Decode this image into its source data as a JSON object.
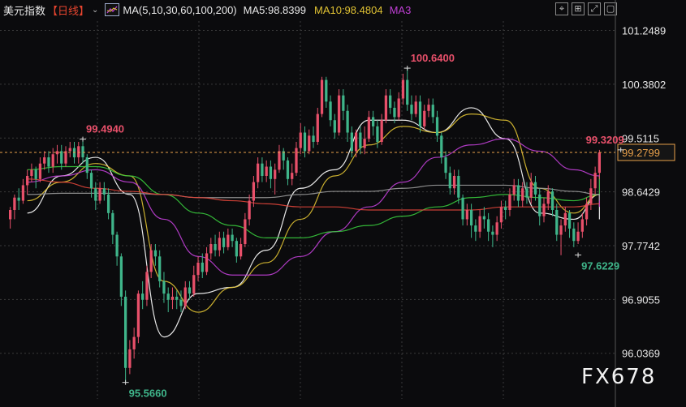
{
  "header": {
    "symbol": "美元指数",
    "period": "【日线】",
    "caret": "⌄",
    "ma_label": "MA(5,10,30,60,100,200)",
    "ma5": "MA5:98.8399",
    "ma10": "MA10:98.4804",
    "ma3": "MA3"
  },
  "toolbar": {
    "icons": [
      "crosshair-icon",
      "zoom-fit-icon",
      "fullscreen-icon",
      "window-icon"
    ],
    "glyphs": [
      "⌖",
      "⊞",
      "⤢",
      "▢"
    ]
  },
  "watermark": "FX678",
  "colors": {
    "up": "#e8506a",
    "down": "#3fb58a",
    "ma5": "#ffffff",
    "ma10": "#e0c233",
    "ma30": "#c03fd6",
    "ma60": "#37c93c",
    "ma100": "#9a9a9a",
    "ma200": "#e0453a",
    "current_price": "#e8a04a",
    "axis_text": "#e8e8e8",
    "grid": "#3a3a3a"
  },
  "chart_data": {
    "type": "candlestick",
    "ylim": [
      95.3,
      101.4
    ],
    "y_ticks": [
      "101.2489",
      "100.3802",
      "99.5115",
      "98.6429",
      "97.7742",
      "96.9055",
      "96.0369"
    ],
    "y_tick_values": [
      101.2489,
      100.3802,
      99.5115,
      98.6429,
      97.7742,
      96.9055,
      96.0369
    ],
    "grid": true,
    "current_price": 99.2799,
    "current_price_label": "99.2799",
    "annotations": [
      {
        "label": "99.4940",
        "index": 17,
        "value": 99.494,
        "color": "#e8506a"
      },
      {
        "label": "95.5660",
        "index": 27,
        "value": 95.566,
        "color": "#3fb58a"
      },
      {
        "label": "100.6400",
        "index": 93,
        "value": 100.64,
        "color": "#e8506a"
      },
      {
        "label": "99.3209",
        "index": 143,
        "value": 99.3209,
        "color": "#e8506a"
      },
      {
        "label": "97.6229",
        "index": 133,
        "value": 97.6229,
        "color": "#3fb58a"
      }
    ],
    "candles": [
      [
        98.2,
        98.35,
        98.05,
        98.4
      ],
      [
        98.35,
        98.55,
        98.2,
        98.6
      ],
      [
        98.55,
        98.5,
        98.35,
        98.7
      ],
      [
        98.5,
        98.75,
        98.45,
        98.85
      ],
      [
        98.75,
        98.9,
        98.6,
        99.0
      ],
      [
        98.9,
        99.0,
        98.8,
        99.1
      ],
      [
        99.0,
        98.85,
        98.7,
        99.05
      ],
      [
        98.85,
        99.1,
        98.8,
        99.2
      ],
      [
        99.1,
        99.2,
        99.0,
        99.3
      ],
      [
        99.2,
        99.05,
        98.95,
        99.3
      ],
      [
        99.05,
        99.25,
        98.95,
        99.35
      ],
      [
        99.25,
        99.3,
        99.1,
        99.4
      ],
      [
        99.3,
        99.1,
        99.0,
        99.4
      ],
      [
        99.1,
        99.3,
        99.05,
        99.38
      ],
      [
        99.3,
        99.35,
        99.2,
        99.45
      ],
      [
        99.35,
        99.2,
        99.1,
        99.45
      ],
      [
        99.2,
        99.38,
        99.1,
        99.45
      ],
      [
        99.38,
        99.2,
        99.1,
        99.49
      ],
      [
        99.2,
        98.95,
        98.85,
        99.25
      ],
      [
        98.95,
        98.7,
        98.55,
        99.0
      ],
      [
        98.7,
        98.5,
        98.35,
        98.8
      ],
      [
        98.5,
        98.7,
        98.45,
        98.8
      ],
      [
        98.7,
        98.6,
        98.5,
        98.8
      ],
      [
        98.6,
        98.3,
        98.2,
        98.7
      ],
      [
        98.3,
        97.95,
        97.8,
        98.35
      ],
      [
        97.95,
        97.6,
        97.45,
        98.0
      ],
      [
        97.6,
        96.95,
        96.8,
        97.65
      ],
      [
        96.95,
        95.8,
        95.57,
        97.05
      ],
      [
        95.8,
        96.1,
        95.7,
        96.25
      ],
      [
        96.1,
        96.3,
        95.95,
        96.45
      ],
      [
        96.3,
        97.0,
        96.2,
        97.05
      ],
      [
        97.0,
        96.9,
        96.75,
        97.2
      ],
      [
        96.9,
        97.35,
        96.8,
        97.45
      ],
      [
        97.35,
        97.7,
        97.25,
        97.8
      ],
      [
        97.7,
        97.6,
        97.45,
        97.8
      ],
      [
        97.6,
        97.2,
        97.1,
        97.7
      ],
      [
        97.2,
        97.0,
        96.85,
        97.35
      ],
      [
        97.0,
        96.9,
        96.7,
        97.1
      ],
      [
        96.9,
        96.95,
        96.75,
        97.1
      ],
      [
        96.95,
        96.9,
        96.75,
        97.05
      ],
      [
        96.9,
        96.8,
        96.7,
        97.05
      ],
      [
        96.8,
        97.1,
        96.75,
        97.2
      ],
      [
        97.1,
        97.0,
        96.9,
        97.2
      ],
      [
        97.0,
        97.3,
        96.95,
        97.45
      ],
      [
        97.3,
        97.5,
        97.2,
        97.6
      ],
      [
        97.5,
        97.35,
        97.25,
        97.65
      ],
      [
        97.35,
        97.65,
        97.3,
        97.75
      ],
      [
        97.65,
        97.8,
        97.55,
        97.9
      ],
      [
        97.8,
        97.7,
        97.6,
        97.95
      ],
      [
        97.7,
        97.9,
        97.6,
        98.0
      ],
      [
        97.9,
        97.75,
        97.65,
        98.0
      ],
      [
        97.75,
        97.95,
        97.7,
        98.05
      ],
      [
        97.95,
        97.85,
        97.75,
        98.05
      ],
      [
        97.85,
        97.6,
        97.5,
        97.9
      ],
      [
        97.6,
        97.8,
        97.55,
        97.9
      ],
      [
        97.8,
        98.2,
        97.75,
        98.3
      ],
      [
        98.2,
        98.5,
        98.1,
        98.6
      ],
      [
        98.5,
        98.8,
        98.4,
        98.9
      ],
      [
        98.8,
        99.1,
        98.7,
        99.2
      ],
      [
        99.1,
        98.9,
        98.8,
        99.2
      ],
      [
        98.9,
        99.05,
        98.8,
        99.15
      ],
      [
        99.05,
        98.85,
        98.7,
        99.15
      ],
      [
        98.85,
        99.0,
        98.6,
        99.1
      ],
      [
        99.0,
        99.3,
        98.95,
        99.4
      ],
      [
        99.3,
        99.15,
        99.0,
        99.35
      ],
      [
        99.15,
        98.85,
        98.75,
        99.2
      ],
      [
        98.85,
        98.95,
        98.75,
        99.1
      ],
      [
        98.95,
        99.35,
        98.9,
        99.45
      ],
      [
        99.35,
        99.6,
        99.25,
        99.75
      ],
      [
        99.6,
        99.3,
        99.2,
        99.7
      ],
      [
        99.3,
        99.55,
        99.25,
        99.65
      ],
      [
        99.55,
        99.45,
        99.35,
        99.7
      ],
      [
        99.45,
        99.9,
        99.4,
        100.0
      ],
      [
        99.9,
        100.45,
        99.85,
        100.5
      ],
      [
        100.45,
        100.1,
        100.0,
        100.5
      ],
      [
        100.1,
        99.8,
        99.7,
        100.2
      ],
      [
        99.8,
        99.6,
        99.5,
        99.9
      ],
      [
        99.6,
        100.2,
        99.55,
        100.3
      ],
      [
        100.2,
        99.95,
        99.8,
        100.3
      ],
      [
        99.95,
        99.6,
        99.45,
        100.05
      ],
      [
        99.6,
        99.3,
        99.2,
        99.7
      ],
      [
        99.3,
        99.6,
        99.2,
        99.65
      ],
      [
        99.6,
        99.35,
        99.25,
        99.7
      ],
      [
        99.35,
        99.5,
        99.25,
        99.7
      ],
      [
        99.5,
        99.85,
        99.45,
        99.95
      ],
      [
        99.85,
        99.7,
        99.55,
        99.95
      ],
      [
        99.7,
        99.45,
        99.35,
        99.8
      ],
      [
        99.45,
        99.8,
        99.4,
        99.9
      ],
      [
        99.8,
        100.2,
        99.75,
        100.3
      ],
      [
        100.2,
        100.0,
        99.9,
        100.3
      ],
      [
        100.0,
        99.85,
        99.75,
        100.1
      ],
      [
        99.85,
        100.15,
        99.8,
        100.25
      ],
      [
        100.15,
        100.45,
        100.05,
        100.55
      ],
      [
        100.45,
        100.05,
        99.95,
        100.64
      ],
      [
        100.05,
        99.9,
        99.8,
        100.2
      ],
      [
        99.9,
        100.1,
        99.85,
        100.2
      ],
      [
        100.1,
        99.7,
        99.6,
        100.2
      ],
      [
        99.7,
        99.95,
        99.65,
        100.05
      ],
      [
        99.95,
        100.05,
        99.85,
        100.15
      ],
      [
        100.05,
        99.85,
        99.75,
        100.15
      ],
      [
        99.85,
        99.55,
        99.45,
        99.95
      ],
      [
        99.55,
        99.2,
        99.1,
        99.6
      ],
      [
        99.2,
        98.95,
        98.85,
        99.3
      ],
      [
        98.95,
        98.7,
        98.6,
        99.05
      ],
      [
        98.7,
        98.9,
        98.6,
        99.0
      ],
      [
        98.9,
        98.55,
        98.45,
        99.0
      ],
      [
        98.55,
        98.2,
        98.1,
        98.6
      ],
      [
        98.2,
        98.35,
        98.1,
        98.45
      ],
      [
        98.35,
        98.1,
        97.9,
        98.45
      ],
      [
        98.1,
        98.0,
        97.85,
        98.2
      ],
      [
        98.0,
        98.25,
        97.9,
        98.35
      ],
      [
        98.25,
        98.2,
        98.05,
        98.4
      ],
      [
        98.2,
        98.0,
        97.85,
        98.3
      ],
      [
        98.0,
        97.95,
        97.75,
        98.1
      ],
      [
        97.95,
        98.15,
        97.85,
        98.25
      ],
      [
        98.15,
        98.4,
        98.05,
        98.5
      ],
      [
        98.4,
        98.35,
        98.2,
        98.5
      ],
      [
        98.35,
        98.6,
        98.25,
        98.7
      ],
      [
        98.6,
        98.75,
        98.5,
        98.85
      ],
      [
        98.75,
        98.5,
        98.4,
        98.85
      ],
      [
        98.5,
        98.7,
        98.4,
        98.8
      ],
      [
        98.7,
        98.55,
        98.45,
        98.8
      ],
      [
        98.55,
        98.8,
        98.45,
        98.95
      ],
      [
        98.8,
        98.6,
        98.5,
        98.9
      ],
      [
        98.6,
        98.25,
        98.1,
        98.7
      ],
      [
        98.25,
        98.45,
        98.15,
        98.55
      ],
      [
        98.45,
        98.65,
        98.35,
        98.75
      ],
      [
        98.65,
        98.35,
        98.25,
        98.7
      ],
      [
        98.35,
        97.95,
        97.85,
        98.45
      ],
      [
        97.95,
        98.1,
        97.62,
        98.2
      ],
      [
        98.1,
        98.3,
        98.0,
        98.4
      ],
      [
        98.3,
        98.05,
        97.9,
        98.35
      ],
      [
        98.05,
        97.85,
        97.75,
        98.15
      ],
      [
        97.85,
        98.0,
        97.8,
        98.15
      ],
      [
        98.0,
        98.2,
        97.9,
        98.3
      ],
      [
        98.2,
        98.45,
        98.1,
        98.55
      ],
      [
        98.45,
        98.7,
        98.35,
        98.85
      ],
      [
        98.7,
        98.95,
        98.6,
        99.05
      ],
      [
        98.95,
        99.28,
        98.85,
        99.32
      ]
    ],
    "ma_lines": [
      {
        "name": "MA5",
        "values_every_8": [
          98.3,
          98.9,
          99.2,
          98.6,
          96.3,
          97.0,
          97.1,
          97.7,
          98.7,
          99.0,
          99.8,
          99.8,
          99.6,
          100.0,
          99.5,
          98.3,
          98.2,
          98.6,
          98.4,
          98.2
        ]
      },
      {
        "name": "MA10",
        "values_every_8": [
          98.5,
          98.8,
          99.1,
          98.9,
          97.2,
          96.7,
          97.1,
          97.5,
          98.2,
          98.9,
          99.4,
          99.7,
          99.6,
          99.9,
          99.8,
          98.7,
          98.3,
          98.6,
          98.4,
          98.4
        ]
      },
      {
        "name": "MA30",
        "values_every_8": [
          98.8,
          98.9,
          99.0,
          98.8,
          98.2,
          97.6,
          97.3,
          97.3,
          97.6,
          98.0,
          98.4,
          98.8,
          99.2,
          99.4,
          99.5,
          99.3,
          99.0,
          98.9,
          98.7,
          98.4
        ]
      },
      {
        "name": "MA60",
        "values_every_8": [
          99.0,
          99.05,
          99.05,
          98.9,
          98.6,
          98.3,
          98.1,
          97.9,
          97.9,
          98.0,
          98.1,
          98.25,
          98.4,
          98.55,
          98.6,
          98.55,
          98.5,
          98.6,
          98.7,
          98.9
        ]
      },
      {
        "name": "MA100",
        "values_every_8": [
          98.6,
          98.62,
          98.62,
          98.62,
          98.6,
          98.55,
          98.55,
          98.55,
          98.6,
          98.65,
          98.65,
          98.7,
          98.75,
          98.75,
          98.75,
          98.7,
          98.65,
          98.6,
          98.55,
          98.5
        ]
      },
      {
        "name": "MA200",
        "values_every_8": [
          98.85,
          98.8,
          98.7,
          98.65,
          98.6,
          98.55,
          98.5,
          98.45,
          98.4,
          98.4,
          98.35,
          98.35,
          98.35,
          98.35,
          98.4,
          98.4,
          98.4,
          98.45,
          98.45,
          98.45
        ]
      }
    ]
  }
}
